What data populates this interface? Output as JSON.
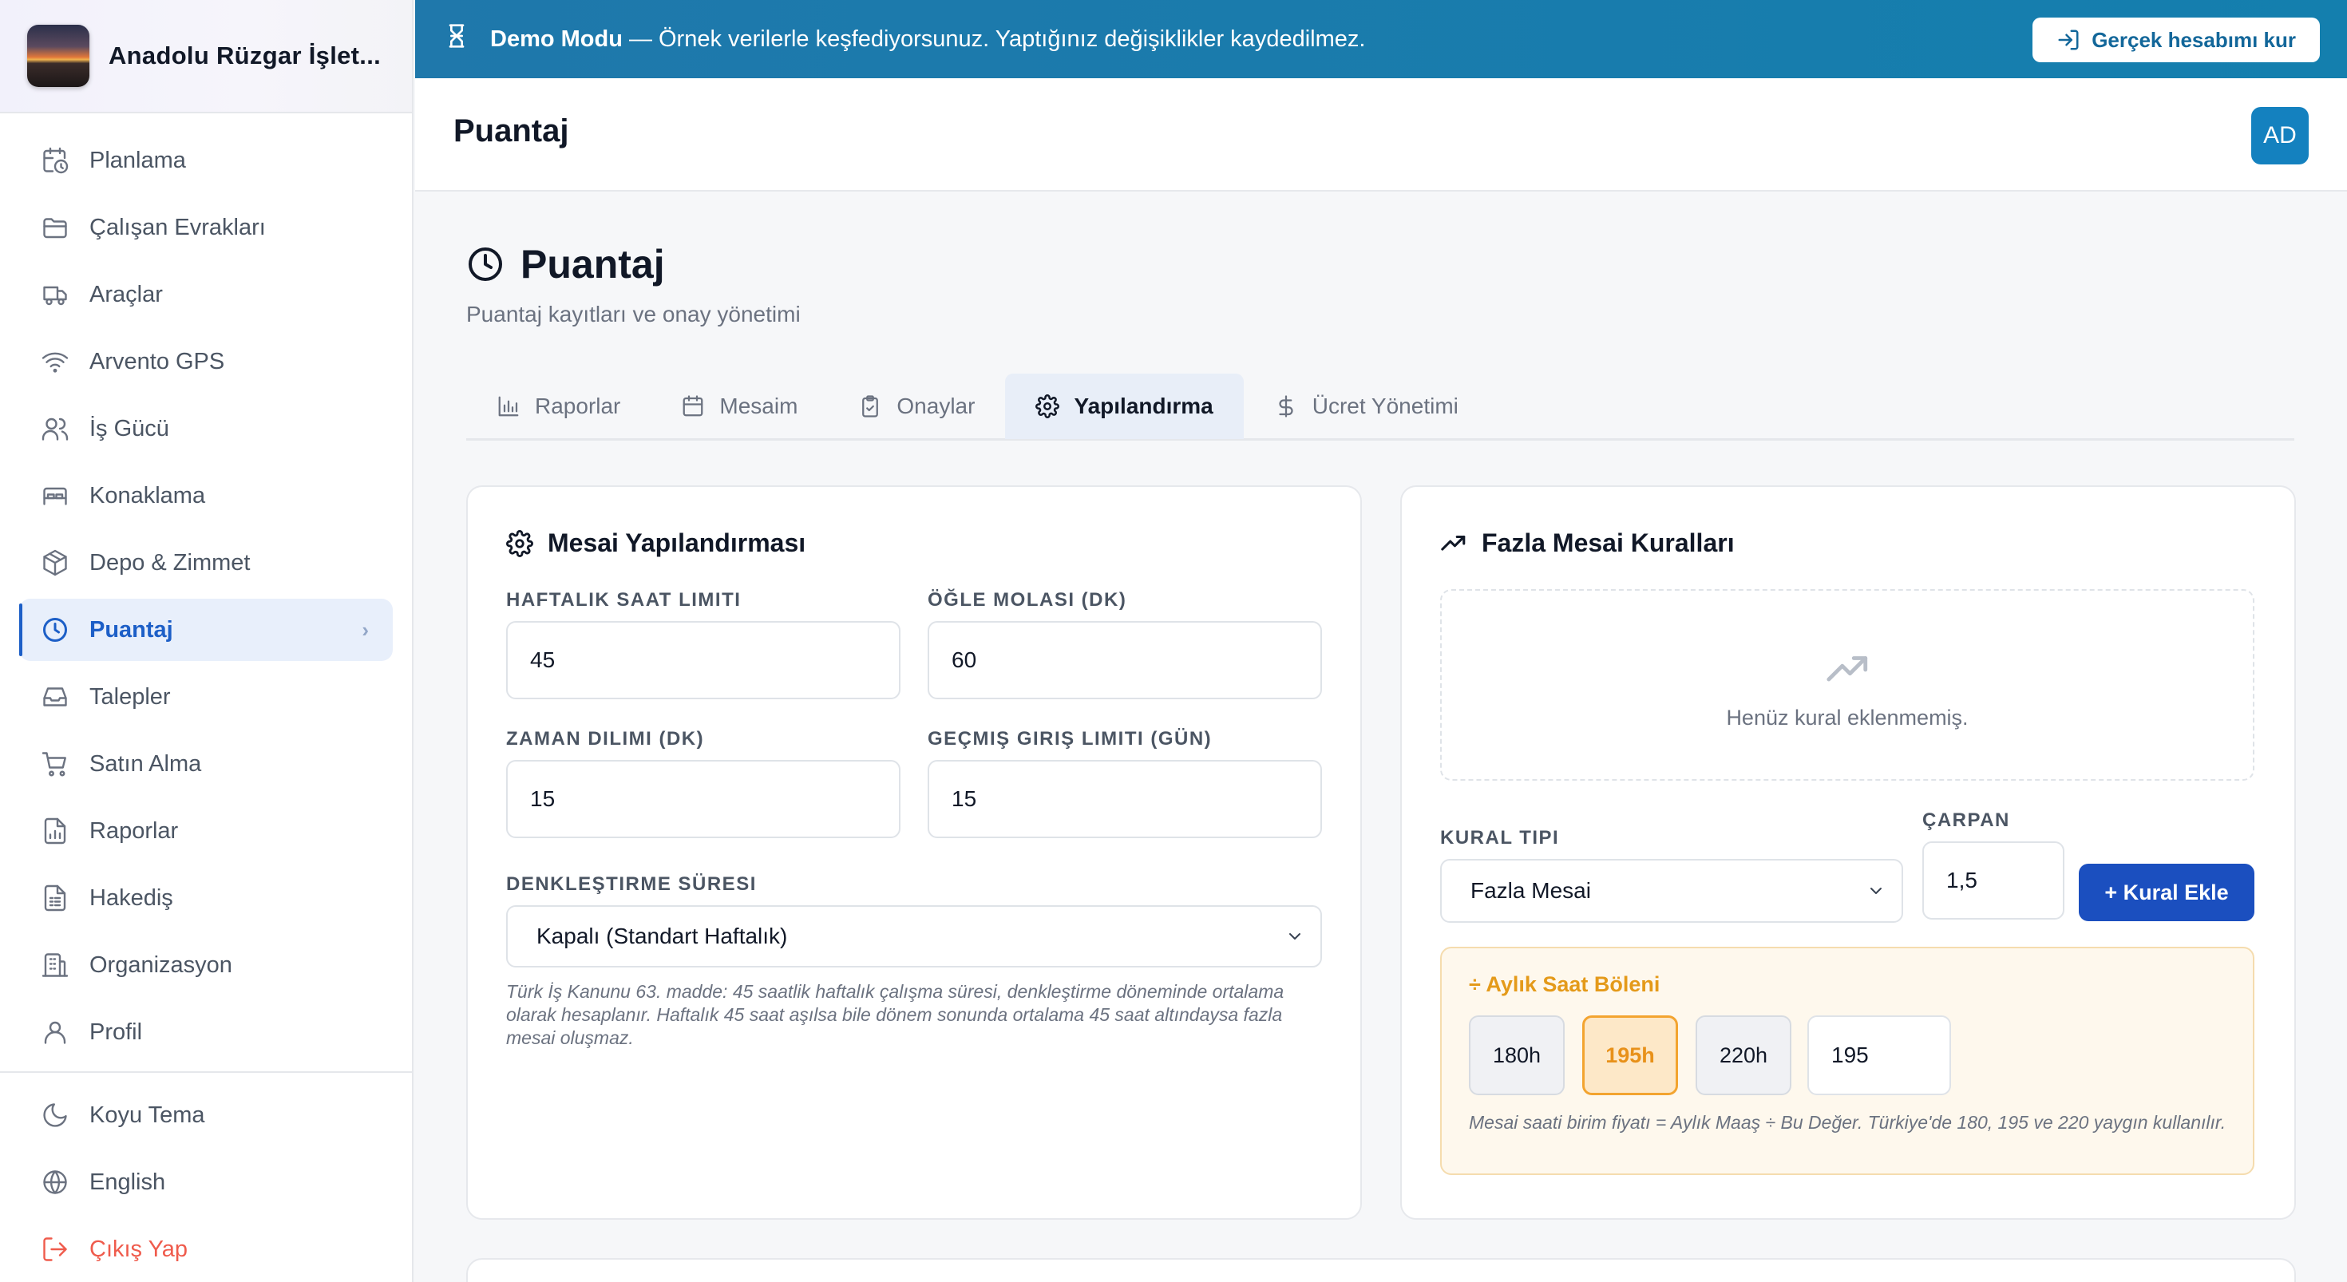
{
  "sidebar": {
    "brand_name": "Anadolu Rüzgar İşlet...",
    "items": [
      {
        "label": "Planlama",
        "icon": "calendar-clock-icon"
      },
      {
        "label": "Çalışan Evrakları",
        "icon": "folder-icon"
      },
      {
        "label": "Araçlar",
        "icon": "truck-icon"
      },
      {
        "label": "Arvento GPS",
        "icon": "wifi-icon"
      },
      {
        "label": "İş Gücü",
        "icon": "users-icon"
      },
      {
        "label": "Konaklama",
        "icon": "bed-icon"
      },
      {
        "label": "Depo & Zimmet",
        "icon": "package-icon"
      },
      {
        "label": "Puantaj",
        "icon": "clock-icon",
        "active": true
      },
      {
        "label": "Talepler",
        "icon": "inbox-icon"
      },
      {
        "label": "Satın Alma",
        "icon": "cart-icon"
      },
      {
        "label": "Raporlar",
        "icon": "file-chart-icon"
      },
      {
        "label": "Hakediş",
        "icon": "file-list-icon"
      },
      {
        "label": "Organizasyon",
        "icon": "building-icon"
      },
      {
        "label": "Profil",
        "icon": "user-icon"
      }
    ],
    "footer": [
      {
        "label": "Koyu Tema",
        "icon": "moon-icon"
      },
      {
        "label": "English",
        "icon": "globe-icon"
      },
      {
        "label": "Çıkış Yap",
        "icon": "logout-icon"
      }
    ]
  },
  "banner": {
    "title": "Demo Modu",
    "text": "— Örnek verilerle keşfediyorsunuz. Yaptığınız değişiklikler kaydedilmez.",
    "button": "Gerçek hesabımı kur"
  },
  "topbar": {
    "title": "Puantaj",
    "avatar": "AD"
  },
  "page": {
    "title": "Puantaj",
    "subtitle": "Puantaj kayıtları ve onay yönetimi"
  },
  "tabs": [
    {
      "label": "Raporlar",
      "icon": "bar-chart-icon"
    },
    {
      "label": "Mesaim",
      "icon": "calendar-icon"
    },
    {
      "label": "Onaylar",
      "icon": "clipboard-check-icon"
    },
    {
      "label": "Yapılandırma",
      "icon": "gear-icon",
      "active": true
    },
    {
      "label": "Ücret Yönetimi",
      "icon": "dollar-icon"
    }
  ],
  "overtime_config": {
    "title": "Mesai Yapılandırması",
    "weekly_limit_label": "HAFTALIK SAAT LIMITI",
    "weekly_limit_value": "45",
    "lunch_break_label": "ÖĞLE MOLASI (DK)",
    "lunch_break_value": "60",
    "time_slot_label": "ZAMAN DILIMI (DK)",
    "time_slot_value": "15",
    "past_entry_label": "GEÇMIŞ GIRIŞ LIMITI (GÜN)",
    "past_entry_value": "15",
    "balancing_label": "DENKLEŞTIRME SÜRESI",
    "balancing_value": "Kapalı (Standart Haftalık)",
    "note": "Türk İş Kanunu 63. madde: 45 saatlik haftalık çalışma süresi, denkleştirme döneminde ortalama olarak hesaplanır. Haftalık 45 saat aşılsa bile dönem sonunda ortalama 45 saat altındaysa fazla mesai oluşmaz."
  },
  "overtime_rules": {
    "title": "Fazla Mesai Kuralları",
    "empty_text": "Henüz kural eklenmemiş.",
    "rule_type_label": "KURAL TIPI",
    "rule_type_value": "Fazla Mesai",
    "multiplier_label": "ÇARPAN",
    "multiplier_value": "1,5",
    "add_button": "+ Kural Ekle",
    "divisor": {
      "title": "÷ Aylık Saat Böleni",
      "options": [
        "180h",
        "195h",
        "220h"
      ],
      "selected": "195h",
      "custom_value": "195",
      "note": "Mesai saati birim fiyatı = Aylık Maaş ÷ Bu Değer. Türkiye'de 180, 195 ve 220 yaygın kullanılır."
    }
  },
  "colors": {
    "accent": "#1d5fc7",
    "banner": "#1679ad",
    "logout": "#ef5b4c",
    "divisor_accent": "#f3a430",
    "add_button": "#1b4fbf"
  }
}
